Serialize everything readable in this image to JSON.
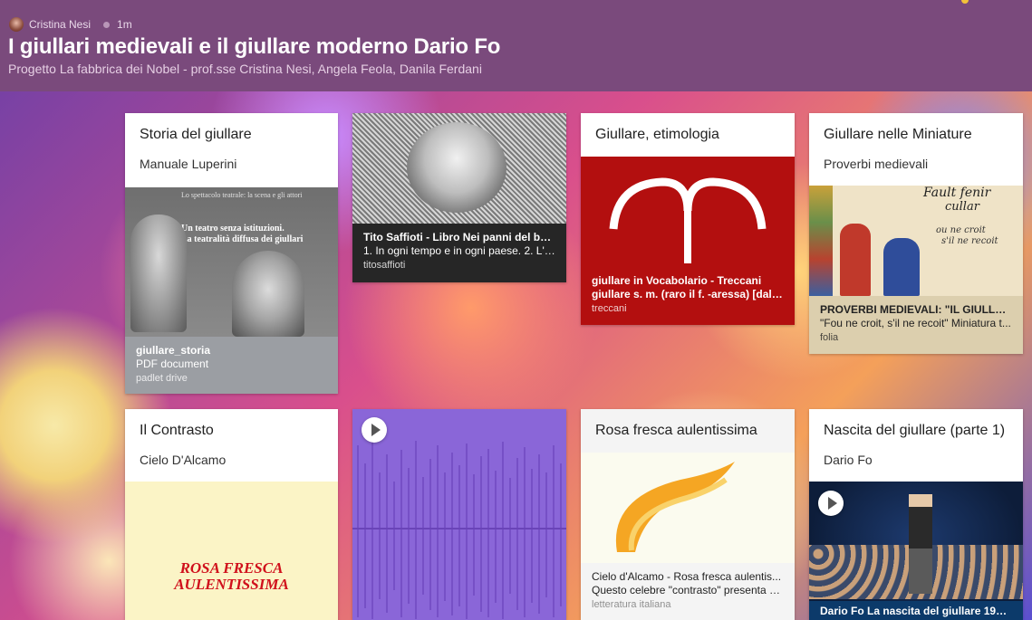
{
  "header": {
    "author": "Cristina Nesi",
    "time": "1m",
    "title": "I giullari medievali e il giullare moderno Dario Fo",
    "subtitle": "Progetto La fabbrica dei Nobel - prof.sse Cristina Nesi, Angela Feola, Danila Ferdani"
  },
  "cards": {
    "storia": {
      "title": "Storia del giullare",
      "body": "Manuale Luperini",
      "att_title": "giullare_storia",
      "att_desc": "PDF document",
      "att_source": "padlet drive",
      "scan_header": "Lo spettacolo teatrale: la scena e gli attori",
      "scan_heading1": "Un teatro senza istituzioni.",
      "scan_heading2": "La teatralità diffusa dei giullari"
    },
    "saffioti": {
      "att_title": "Tito Saffioti - Libro Nei panni del buff...",
      "att_desc": "1. In ogni tempo e in ogni paese. 2. L'i...",
      "att_source": "titosaffioti"
    },
    "etimologia": {
      "title": "Giullare, etimologia",
      "att_title": "giullare in Vocabolario - Treccani",
      "att_desc": "giullare s. m. (raro il f. -aressa) [dal pr...",
      "att_source": "treccani"
    },
    "miniature": {
      "title": "Giullare nelle Miniature",
      "body": "Proverbi medievali",
      "att_title": "PROVERBI MEDIEVALI: \"IL GIULLARE...",
      "att_desc": "\"Fou ne croit, s'il ne recoit\" Miniatura t...",
      "att_source": "folia",
      "script_line1": "ou ne croit",
      "script_line2": "s'il ne recoit",
      "script_line3": "Fault fenir",
      "script_line4": "cullar"
    },
    "contrasto": {
      "title": "Il Contrasto",
      "body": "Cielo D'Alcamo",
      "poster_line1": "ROSA FRESCA",
      "poster_line2": "AULENTISSIMA"
    },
    "rosa": {
      "title": "Rosa fresca aulentissima",
      "att_title": "Cielo d'Alcamo - Rosa fresca aulentis...",
      "att_desc": "Questo celebre \"contrasto\" presenta u...",
      "att_source": "letteratura italiana"
    },
    "nascita": {
      "title": "Nascita del giullare (parte 1)",
      "body": "Dario Fo",
      "att_title": "Dario Fo La nascita del giullare 1977 ..."
    }
  },
  "colors": {
    "header_bg": "#7a4a7c",
    "treccani_red": "#b30f0f",
    "audio_purple": "#8a66d8"
  }
}
